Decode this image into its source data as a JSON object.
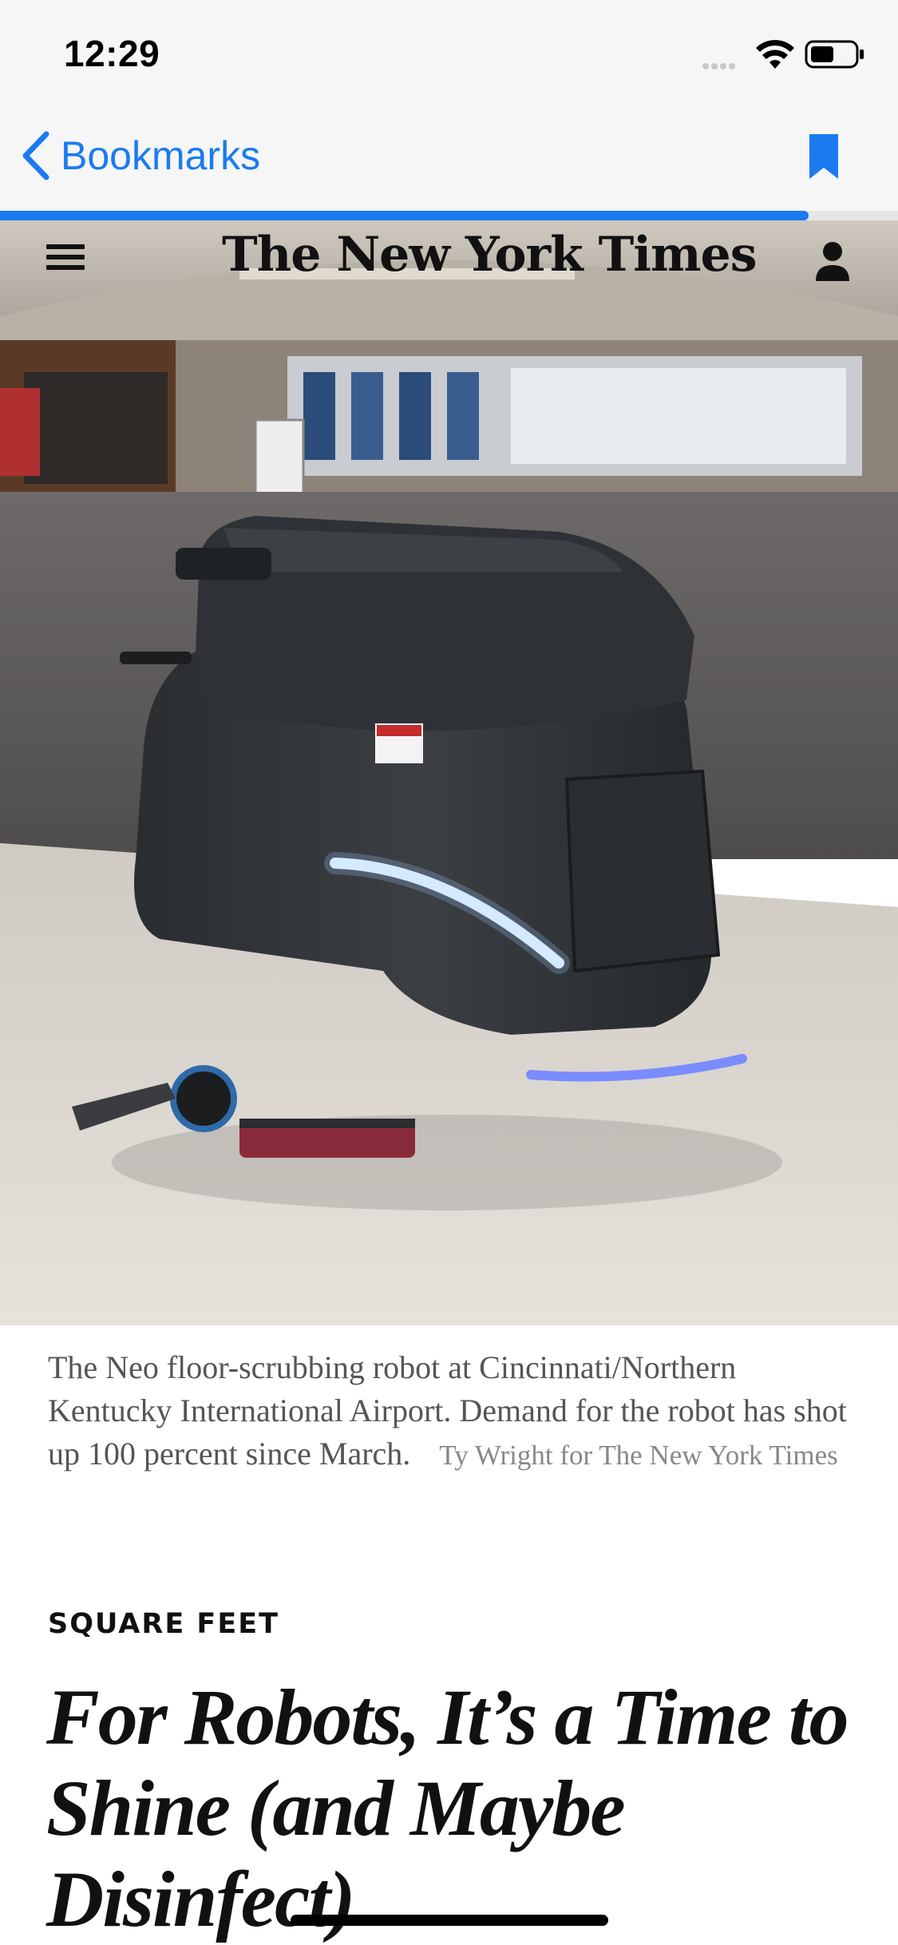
{
  "status_bar": {
    "time": "12:29",
    "icons": [
      "signal-dots-icon",
      "wifi-icon",
      "battery-icon"
    ]
  },
  "nav": {
    "back_label": "Bookmarks",
    "back_icon": "chevron-left-icon",
    "bookmark_icon": "bookmark-filled-icon",
    "accent_color": "#1a7bf0"
  },
  "reading_progress": 0.9,
  "nyt_header": {
    "masthead": "The New York Times",
    "menu_icon": "hamburger-menu-icon",
    "account_icon": "person-icon"
  },
  "article": {
    "image_alt": "Floor-scrubbing robot in an airport concourse",
    "caption": "The Neo floor-scrubbing robot at Cincinnati/Northern Kentucky International Airport. Demand for the robot has shot up 100 percent since March.",
    "credit": "Ty Wright for The New York Times",
    "kicker": "SQUARE FEET",
    "headline": "For Robots, It’s a Time to Shine (and Maybe Disinfect)"
  }
}
